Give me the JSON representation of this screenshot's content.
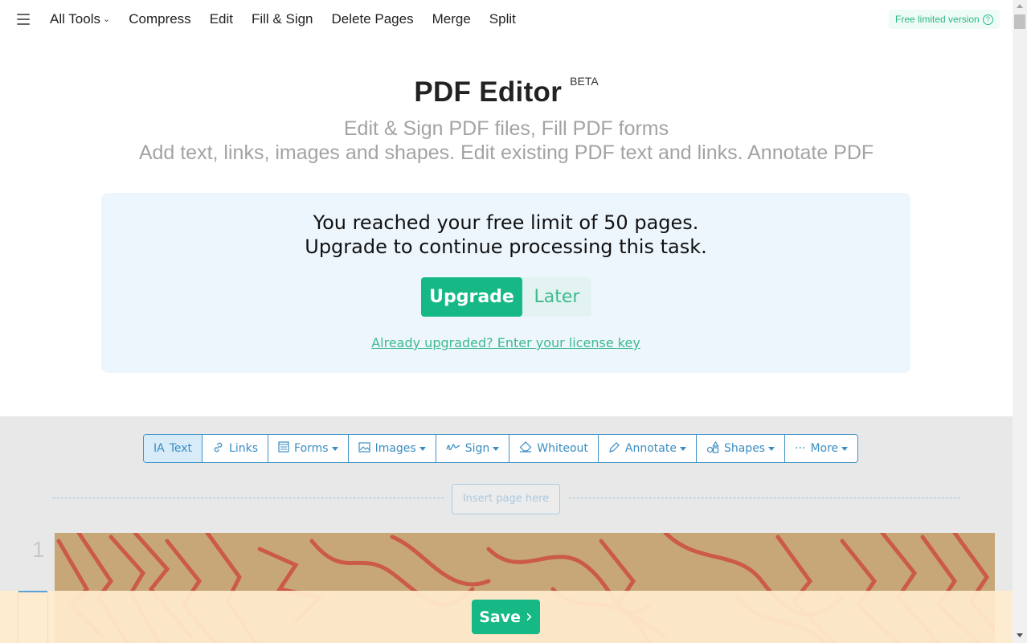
{
  "nav": {
    "menu_icon": "hamburger-icon",
    "items": [
      {
        "label": "All Tools",
        "has_dropdown": true
      },
      {
        "label": "Compress"
      },
      {
        "label": "Edit"
      },
      {
        "label": "Fill & Sign"
      },
      {
        "label": "Delete Pages"
      },
      {
        "label": "Merge"
      },
      {
        "label": "Split"
      }
    ],
    "free_badge": "Free limited version",
    "free_badge_icon": "?"
  },
  "header": {
    "title": "PDF Editor",
    "badge": "BETA",
    "subtitle_1": "Edit & Sign PDF files, Fill PDF forms",
    "subtitle_2": "Add text, links, images and shapes. Edit existing PDF text and links. Annotate PDF"
  },
  "upgrade": {
    "line_1": "You reached your free limit of 50 pages.",
    "line_2": "Upgrade to continue processing this task.",
    "upgrade_label": "Upgrade",
    "later_label": "Later",
    "license_link": "Already upgraded? Enter your license key"
  },
  "toolbar": {
    "tools": [
      {
        "label": "Text",
        "icon": "IA",
        "active": true
      },
      {
        "label": "Links",
        "icon": "🔗"
      },
      {
        "label": "Forms",
        "icon": "▤",
        "dropdown": true
      },
      {
        "label": "Images",
        "icon": "🖼",
        "dropdown": true
      },
      {
        "label": "Sign",
        "icon": "〰",
        "dropdown": true
      },
      {
        "label": "Whiteout",
        "icon": "◇"
      },
      {
        "label": "Annotate",
        "icon": "✎",
        "dropdown": true
      },
      {
        "label": "Shapes",
        "icon": "⧉",
        "dropdown": true
      },
      {
        "label": "More",
        "icon": "···",
        "dropdown": true
      }
    ]
  },
  "editor": {
    "insert_label": "Insert page here",
    "page_number": "1"
  },
  "footer": {
    "save_label": "Save",
    "save_icon": "›"
  },
  "colors": {
    "accent_green": "#16b886",
    "toolbar_blue": "#3a8dc3",
    "upgrade_box_bg": "#eef6fd"
  }
}
